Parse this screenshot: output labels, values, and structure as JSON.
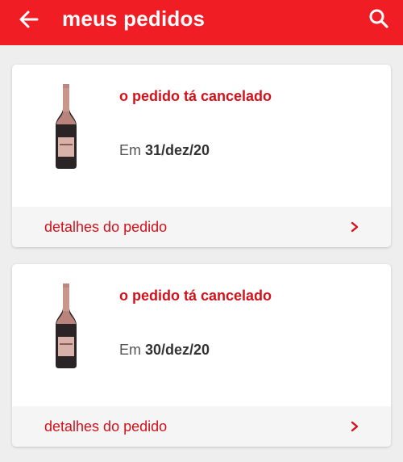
{
  "header": {
    "title": "meus pedidos",
    "background_color": "#f11d24",
    "back_icon": "arrow-left-icon",
    "search_icon": "search-icon"
  },
  "orders": [
    {
      "status": "o pedido tá cancelado",
      "date_prefix": "Em",
      "date": "31/dez/20",
      "details_label": "detalhes do pedido"
    },
    {
      "status": "o pedido tá cancelado",
      "date_prefix": "Em",
      "date": "30/dez/20",
      "details_label": "detalhes do pedido"
    }
  ],
  "colors": {
    "accent": "#d4111a",
    "background": "#eeeeee",
    "card_footer": "#f5f5f5"
  }
}
